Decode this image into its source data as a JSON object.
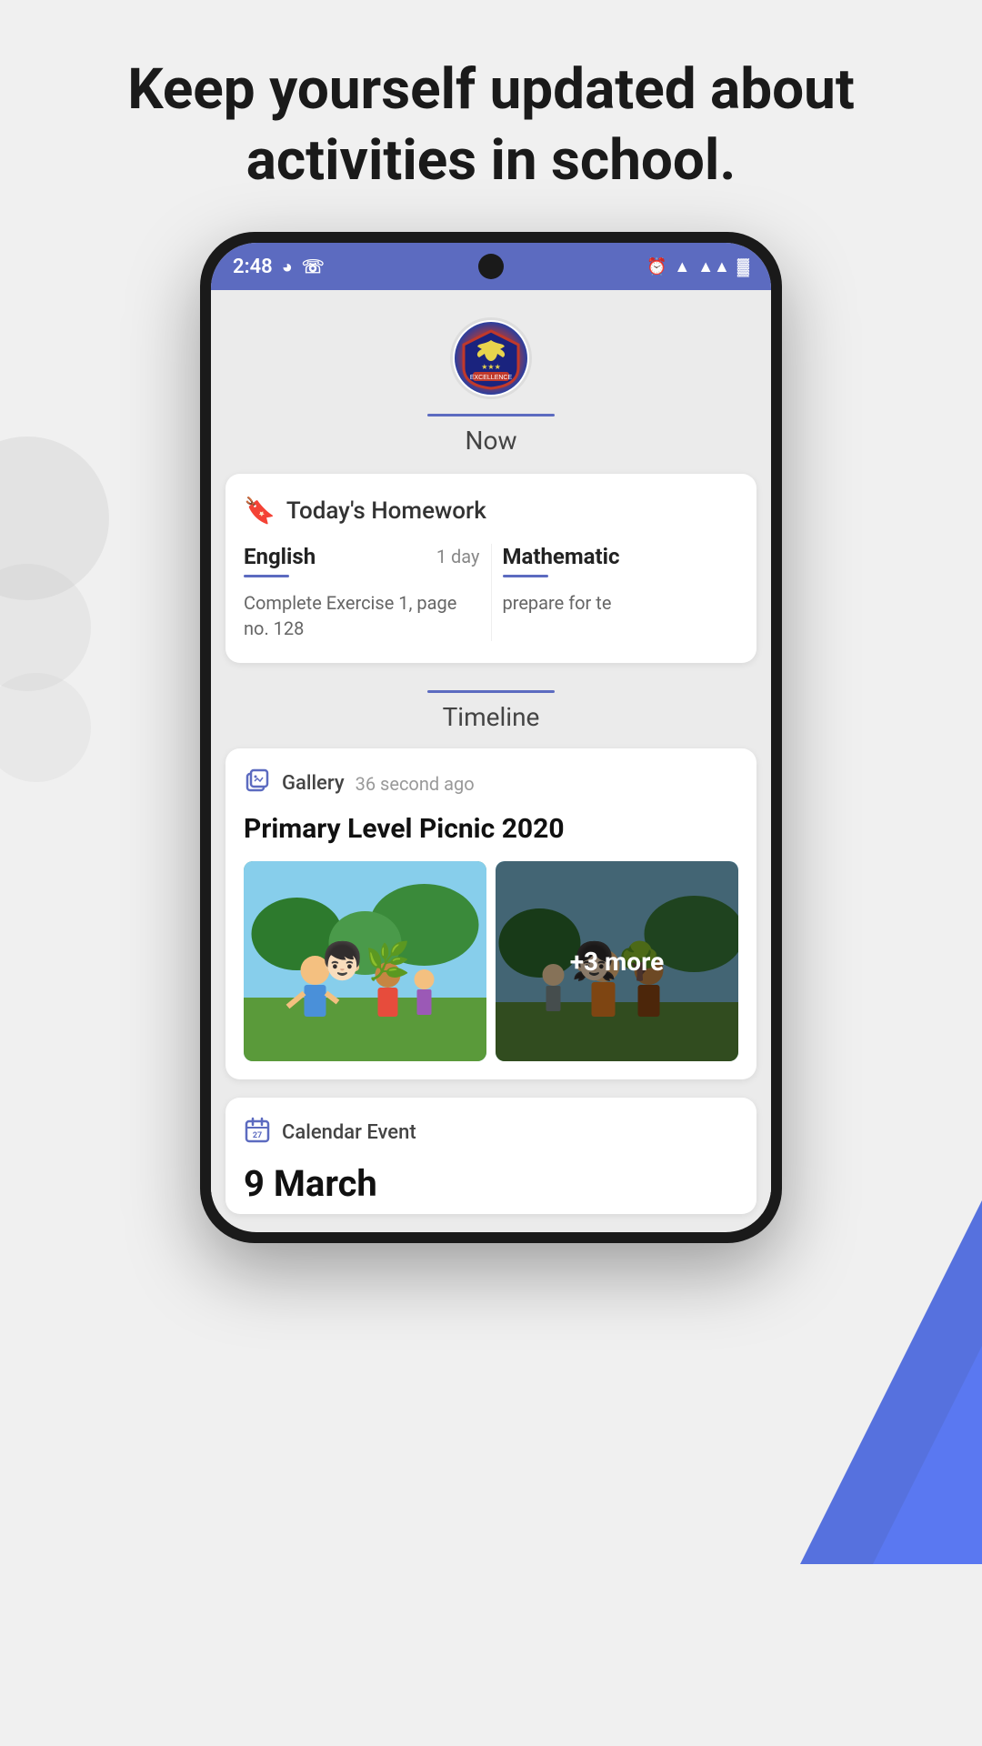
{
  "page": {
    "headline": "Keep yourself updated about activities in school."
  },
  "statusBar": {
    "time": "2:48",
    "icons": [
      "messaging",
      "whatsapp",
      "alarm",
      "wifi",
      "signal",
      "battery"
    ]
  },
  "schoolHeader": {
    "tabLabel": "Now"
  },
  "homeworkSection": {
    "title": "Today's Homework",
    "subjects": [
      {
        "name": "English",
        "days": "1 day",
        "description": "Complete Exercise 1, page no. 128"
      },
      {
        "name": "Mathematic",
        "days": "",
        "description": "prepare for te"
      }
    ]
  },
  "timelineSection": {
    "label": "Timeline",
    "galleryCard": {
      "type": "Gallery",
      "timeAgo": "36 second ago",
      "title": "Primary Level Picnic 2020",
      "moreCount": "+3 more"
    },
    "calendarCard": {
      "type": "Calendar Event",
      "date": "9 March",
      "iconLabel": "calendar"
    }
  }
}
